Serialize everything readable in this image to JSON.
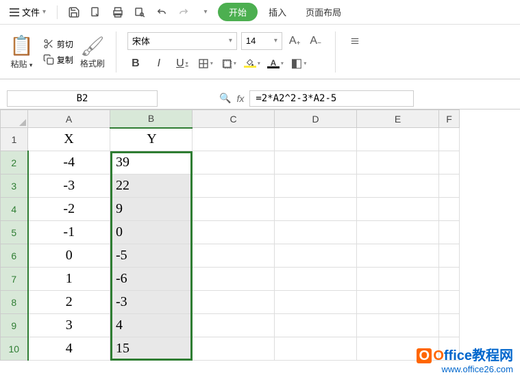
{
  "menubar": {
    "file_label": "文件",
    "start_label": "开始",
    "insert_label": "插入",
    "page_layout_label": "页面布局"
  },
  "ribbon": {
    "paste_label": "粘贴",
    "cut_label": "剪切",
    "copy_label": "复制",
    "format_painter_label": "格式刷",
    "font_name": "宋体",
    "font_size": "14",
    "bold_label": "B",
    "italic_label": "I",
    "underline_label": "U"
  },
  "formula_bar": {
    "cell_ref": "B2",
    "fx_label": "fx",
    "formula": "=2*A2^2-3*A2-5"
  },
  "columns": [
    "A",
    "B",
    "C",
    "D",
    "E",
    "F"
  ],
  "row_headers": [
    "1",
    "2",
    "3",
    "4",
    "5",
    "6",
    "7",
    "8",
    "9",
    "10"
  ],
  "chart_data": {
    "type": "table",
    "headers": {
      "A": "X",
      "B": "Y"
    },
    "rows": [
      {
        "A": "-4",
        "B": "39"
      },
      {
        "A": "-3",
        "B": "22"
      },
      {
        "A": "-2",
        "B": "9"
      },
      {
        "A": "-1",
        "B": "0"
      },
      {
        "A": "0",
        "B": "-5"
      },
      {
        "A": "1",
        "B": "-6"
      },
      {
        "A": "2",
        "B": "-3"
      },
      {
        "A": "3",
        "B": "4"
      },
      {
        "A": "4",
        "B": "15"
      }
    ]
  },
  "watermark": {
    "brand_prefix": "O",
    "brand_rest": "ffice教程网",
    "url": "www.office26.com"
  }
}
